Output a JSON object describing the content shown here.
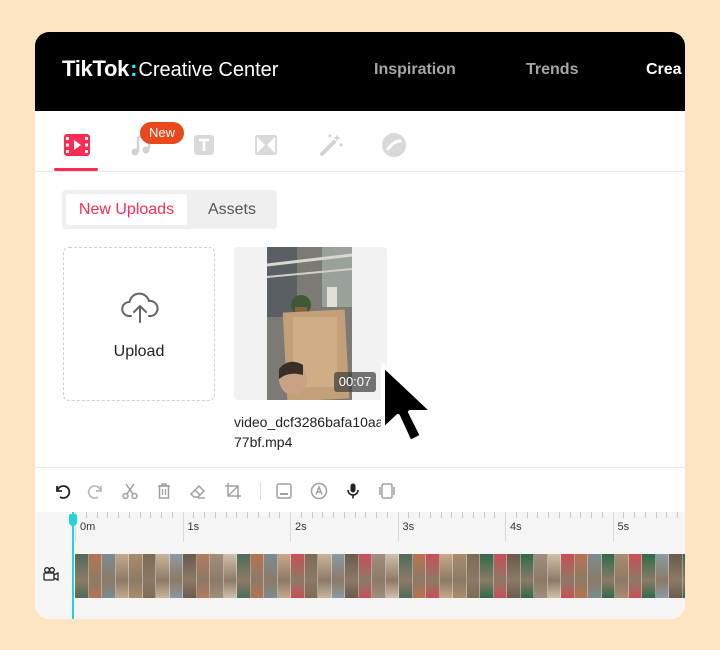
{
  "header": {
    "brand": "TikTok",
    "colon": ":",
    "subtitle": "Creative Center",
    "nav": [
      "Inspiration",
      "Trends",
      "Crea"
    ]
  },
  "tool_tabs": [
    {
      "icon": "video-icon",
      "active": true
    },
    {
      "icon": "music-note-icon",
      "badge": "New"
    },
    {
      "icon": "text-icon"
    },
    {
      "icon": "transition-icon"
    },
    {
      "icon": "magic-wand-icon"
    },
    {
      "icon": "sticker-icon"
    }
  ],
  "media_tabs": {
    "new_uploads": "New Uploads",
    "assets": "Assets"
  },
  "upload": {
    "label": "Upload"
  },
  "video": {
    "duration": "00:07",
    "filename": "video_dcf3286bafa10aa377bf.mp4"
  },
  "editor_tools": [
    "undo-icon",
    "redo-icon",
    "scissors-icon",
    "trash-icon",
    "eraser-icon",
    "crop-icon",
    "subtitle-icon",
    "auto-caption-icon",
    "microphone-icon",
    "fit-icon"
  ],
  "timeline": {
    "ticks": [
      "0m",
      "1s",
      "2s",
      "3s",
      "4s",
      "5s"
    ],
    "track_icon": "video-camera-icon",
    "playhead_seconds": 0
  },
  "colors": {
    "accent": "#fe2c55",
    "playhead": "#25d3d6",
    "badge": "#e8481b",
    "brand_colon": "#25f4ee"
  }
}
